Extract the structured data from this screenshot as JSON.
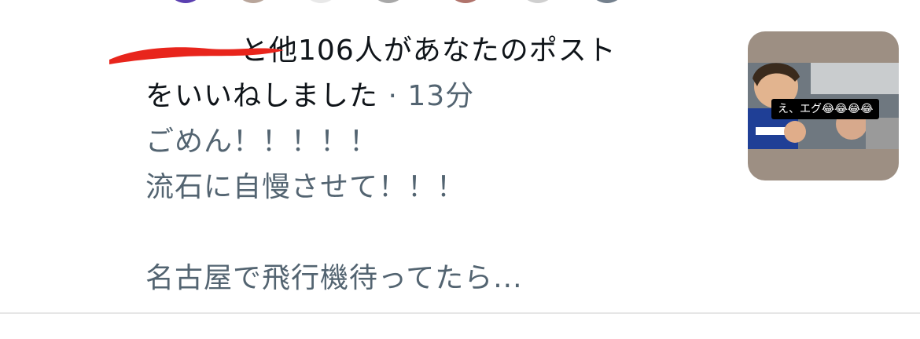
{
  "notification": {
    "actor_tail": "と他",
    "count": "106",
    "action_1": "人があなたのポスト",
    "action_2": "をいいねしました",
    "separator": "·",
    "time": "13分"
  },
  "post_excerpt": {
    "line1": "ごめん！！！！！",
    "line2": "流石に自慢させて！！！",
    "line3": "名古屋で飛行機待ってたら..."
  },
  "thumbnail": {
    "caption": "え、エグ😂😂😂😂"
  },
  "colors": {
    "text_primary": "#0f1419",
    "text_secondary": "#536471",
    "redaction": "#e8251c"
  }
}
